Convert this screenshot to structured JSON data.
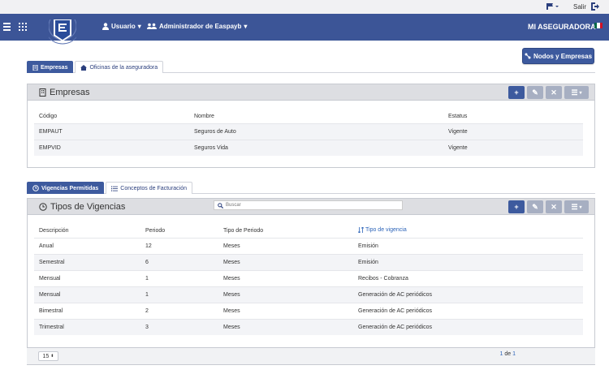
{
  "topbar": {
    "salir": "Salir"
  },
  "navbar": {
    "user_menu": "Usuario",
    "admin_menu": "Administrador de Easpayb",
    "brand": "MI ASEGURADORA",
    "flag_colors": [
      "#006847",
      "#ffffff",
      "#ce1126"
    ]
  },
  "actions": {
    "nodos_button": "Nodos y Empresas"
  },
  "tabs1": [
    {
      "label": "Empresas",
      "icon": "building-icon"
    },
    {
      "label": "Oficinas de la aseguradora",
      "icon": "house-icon"
    }
  ],
  "empresas": {
    "title": "Empresas",
    "columns": [
      "Código",
      "Nombre",
      "Estatus"
    ],
    "rows": [
      [
        "EMPAUT",
        "Seguros de Auto",
        "Vigente"
      ],
      [
        "EMPVID",
        "Seguros Vida",
        "Vigente"
      ]
    ]
  },
  "tabs2": [
    {
      "label": "Vigencias Permitidas",
      "icon": "clock-icon"
    },
    {
      "label": "Conceptos de Facturación",
      "icon": "list-icon"
    }
  ],
  "vigencias": {
    "title": "Tipos de Vigencias",
    "search_placeholder": "Buscar",
    "columns": [
      "Descripción",
      "Periodo",
      "Tipo de Periodo",
      "Tipo de vigencia"
    ],
    "rows": [
      [
        "Anual",
        "12",
        "Meses",
        "Emisión"
      ],
      [
        "Semestral",
        "6",
        "Meses",
        "Emisión"
      ],
      [
        "Mensual",
        "1",
        "Meses",
        "Recibos - Cobranza"
      ],
      [
        "Mensual",
        "1",
        "Meses",
        "Generación de AC periódicos"
      ],
      [
        "Bimestral",
        "2",
        "Meses",
        "Generación de AC periódicos"
      ],
      [
        "Trimestral",
        "3",
        "Meses",
        "Generación de AC periódicos"
      ]
    ]
  },
  "pagination": {
    "page_size": "15",
    "current": "1",
    "of_label": "de",
    "total": "1"
  },
  "colors": {
    "primary": "#3d5a9e",
    "navbar": "#3c5597",
    "link": "#2b63b8"
  }
}
